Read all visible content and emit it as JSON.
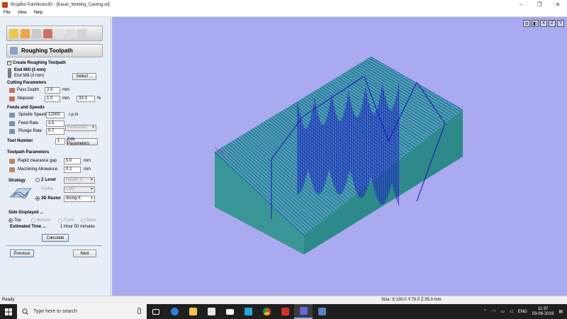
{
  "window": {
    "title": "ShopBot PartWorks3D - [Karan_Molding_Casting.stl]",
    "minimize": "–",
    "maximize": "❐",
    "close": "✕"
  },
  "menu": [
    "File",
    "View",
    "Help"
  ],
  "panel": {
    "section_title": "Roughing Toolpath",
    "create_label": "Create Roughing Toolpath",
    "tool_title": "End Mill (3 mm)",
    "tool_sub": "End Mill (3 mm)",
    "select_button": "Select ...",
    "cutting_header": "Cutting Parameters",
    "pass_depth_label": "Pass Depth",
    "pass_depth_value": "2.5",
    "pass_depth_unit": "mm",
    "stepover_label": "Stepover",
    "stepover_value": "1.0",
    "stepover_unit": "mm",
    "stepover_pct": "33.3",
    "pct_sign": "%",
    "feeds_header": "Feeds and Speeds",
    "spindle_label": "Spindle Speed",
    "spindle_value": "12000",
    "spindle_unit": "r.p.m",
    "feed_label": "Feed Rate",
    "feed_value": "1.5",
    "feed_unit_select": "inches/sec",
    "plunge_label": "Plunge Rate",
    "plunge_value": "0.7",
    "tool_number_label": "Tool Number",
    "tool_number_value": "1",
    "edit_params_button": "Edit Parameters",
    "toolpath_header": "Toolpath Parameters",
    "rapid_label": "Rapid clearance gap",
    "rapid_value": "5.0",
    "rapid_unit": "mm",
    "allowance_label": "Machining Allowance",
    "allowance_value": "0.2",
    "allowance_unit": "mm",
    "strategy_label": "Strategy",
    "zlevel_label": "Z Level",
    "zlevel_select": "Raster X",
    "profile_label": "Profile",
    "profile_select": "Last",
    "raster3d_label": "3D Raster",
    "raster3d_select": "Along X",
    "side_header": "Side Displayed ...",
    "side_top": "Top",
    "side_bottom": "Bottom",
    "side_front": "Front",
    "side_back": "Back",
    "est_label": "Estimated Time ...",
    "est_value": "1 Hour 50 minutes",
    "calculate_button": "Calculate",
    "previous_button": "Previous",
    "next_button": "Next"
  },
  "viewport": {
    "background": "#aaaaf0",
    "toolpath_color": "#1a10c8",
    "top_face_color": "#48a6a6",
    "front_face_color": "#3a9696",
    "side_face_color": "#2e8a8a"
  },
  "view_icons": [
    "reset-view-icon",
    "iso-view-icon",
    "x-view-icon",
    "z-view-icon",
    "y-view-icon"
  ],
  "view_icon_glyphs": [
    "⊡",
    "◧",
    "X",
    "Z",
    "Y"
  ],
  "status": {
    "left": "Ready",
    "size": "Size: X:130.0 Y:70.0 Z:35.0 mm"
  },
  "taskbar": {
    "search_placeholder": "Type here to search",
    "lang": "ENG",
    "time": "11:37",
    "date": "03-06-2019"
  }
}
